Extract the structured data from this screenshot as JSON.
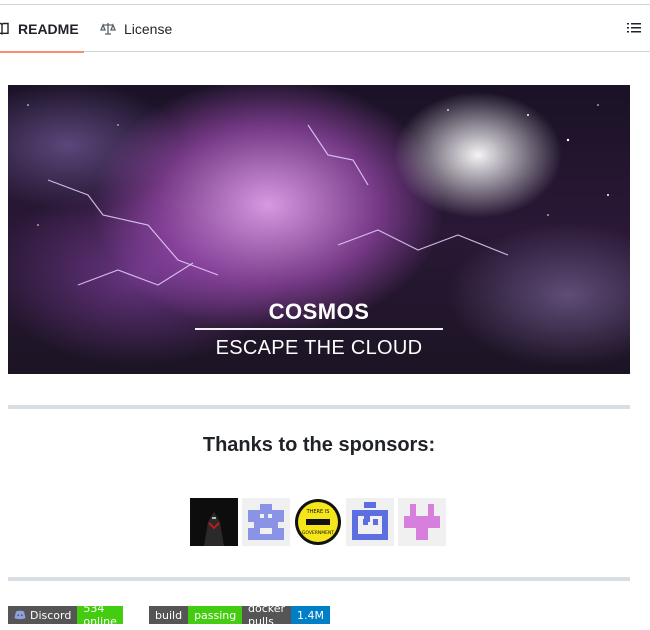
{
  "tabs": {
    "readme_label": "README",
    "license_label": "License"
  },
  "banner": {
    "title": "COSMOS",
    "subtitle": "ESCAPE THE CLOUD"
  },
  "sponsors": {
    "heading": "Thanks to the sponsors:",
    "avatars": [
      {
        "icon": "dark-figure-avatar"
      },
      {
        "icon": "pixel-invader-avatar",
        "color": "#8b93e6"
      },
      {
        "icon": "yellow-seal-avatar",
        "text": "THERE IS NO GOVERNMENT"
      },
      {
        "icon": "pixel-face-avatar",
        "color": "#5d6fe0"
      },
      {
        "icon": "pixel-cross-avatar",
        "color": "#d67fdc"
      }
    ]
  },
  "badges": [
    {
      "label": "Discord",
      "value": "534 online",
      "color": "#4c1"
    },
    {
      "label": "build",
      "value": "passing",
      "color": "#4c1"
    },
    {
      "label": "docker pulls",
      "value": "1.4M",
      "color": "#007ec6"
    }
  ],
  "colors": {
    "tab_underline": "#fd8c73",
    "border": "#d0d7de"
  }
}
